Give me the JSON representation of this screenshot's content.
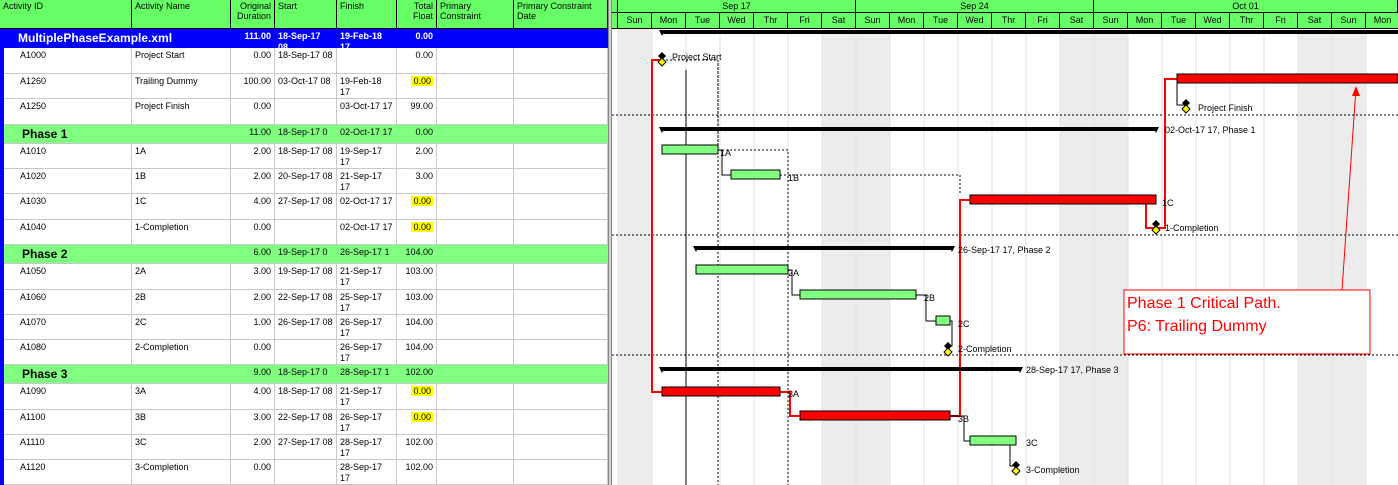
{
  "columns": {
    "activity_id": "Activity ID",
    "activity_name": "Activity Name",
    "original_duration": "Original Duration",
    "start": "Start",
    "finish": "Finish",
    "total_float": "Total Float",
    "primary_constraint": "Primary Constraint",
    "primary_constraint_date": "Primary Constraint Date"
  },
  "rows": [
    {
      "kind": "project",
      "id": "",
      "name": "MultiplePhaseExample.xml",
      "dur": "111.00",
      "start": "18-Sep-17 08",
      "finish": "19-Feb-18 17",
      "float": "0.00",
      "float_hl": false
    },
    {
      "kind": "act",
      "id": "A1000",
      "name": "Project Start",
      "dur": "0.00",
      "start": "18-Sep-17 08",
      "finish": "",
      "float": "0.00",
      "float_hl": false
    },
    {
      "kind": "act",
      "id": "A1260",
      "name": "Trailing Dummy",
      "dur": "100.00",
      "start": "03-Oct-17 08",
      "finish": "19-Feb-18 17",
      "float": "0.00",
      "float_hl": true
    },
    {
      "kind": "act",
      "id": "A1250",
      "name": "Project Finish",
      "dur": "0.00",
      "start": "",
      "finish": "03-Oct-17 17",
      "float": "99.00",
      "float_hl": false
    },
    {
      "kind": "phase",
      "id": "",
      "name": "Phase 1",
      "dur": "11.00",
      "start": "18-Sep-17 0",
      "finish": "02-Oct-17 17",
      "float": "0.00",
      "float_hl": false
    },
    {
      "kind": "act",
      "id": "A1010",
      "name": "1A",
      "dur": "2.00",
      "start": "18-Sep-17 08",
      "finish": "19-Sep-17 17",
      "float": "2.00",
      "float_hl": false
    },
    {
      "kind": "act",
      "id": "A1020",
      "name": "1B",
      "dur": "2.00",
      "start": "20-Sep-17 08",
      "finish": "21-Sep-17 17",
      "float": "3.00",
      "float_hl": false
    },
    {
      "kind": "act",
      "id": "A1030",
      "name": "1C",
      "dur": "4.00",
      "start": "27-Sep-17 08",
      "finish": "02-Oct-17 17",
      "float": "0.00",
      "float_hl": true
    },
    {
      "kind": "act",
      "id": "A1040",
      "name": "1-Completion",
      "dur": "0.00",
      "start": "",
      "finish": "02-Oct-17 17",
      "float": "0.00",
      "float_hl": true
    },
    {
      "kind": "phase",
      "id": "",
      "name": "Phase 2",
      "dur": "6.00",
      "start": "19-Sep-17 0",
      "finish": "26-Sep-17 1",
      "float": "104.00",
      "float_hl": false
    },
    {
      "kind": "act",
      "id": "A1050",
      "name": "2A",
      "dur": "3.00",
      "start": "19-Sep-17 08",
      "finish": "21-Sep-17 17",
      "float": "103.00",
      "float_hl": false
    },
    {
      "kind": "act",
      "id": "A1060",
      "name": "2B",
      "dur": "2.00",
      "start": "22-Sep-17 08",
      "finish": "25-Sep-17 17",
      "float": "103.00",
      "float_hl": false
    },
    {
      "kind": "act",
      "id": "A1070",
      "name": "2C",
      "dur": "1.00",
      "start": "26-Sep-17 08",
      "finish": "26-Sep-17 17",
      "float": "104.00",
      "float_hl": false
    },
    {
      "kind": "act",
      "id": "A1080",
      "name": "2-Completion",
      "dur": "0.00",
      "start": "",
      "finish": "26-Sep-17 17",
      "float": "104.00",
      "float_hl": false
    },
    {
      "kind": "phase",
      "id": "",
      "name": "Phase 3",
      "dur": "9.00",
      "start": "18-Sep-17 0",
      "finish": "28-Sep-17 1",
      "float": "102.00",
      "float_hl": false
    },
    {
      "kind": "act",
      "id": "A1090",
      "name": "3A",
      "dur": "4.00",
      "start": "18-Sep-17 08",
      "finish": "21-Sep-17 17",
      "float": "0.00",
      "float_hl": true
    },
    {
      "kind": "act",
      "id": "A1100",
      "name": "3B",
      "dur": "3.00",
      "start": "22-Sep-17 08",
      "finish": "26-Sep-17 17",
      "float": "0.00",
      "float_hl": true
    },
    {
      "kind": "act",
      "id": "A1110",
      "name": "3C",
      "dur": "2.00",
      "start": "27-Sep-17 08",
      "finish": "28-Sep-17 17",
      "float": "102.00",
      "float_hl": false
    },
    {
      "kind": "act",
      "id": "A1120",
      "name": "3-Completion",
      "dur": "0.00",
      "start": "",
      "finish": "28-Sep-17 17",
      "float": "102.00",
      "float_hl": false
    }
  ],
  "timescale": {
    "weeks": [
      "",
      "Sep 17",
      "Sep 24",
      "Oct 01"
    ],
    "days": [
      "Sun",
      "Mon",
      "Tue",
      "Wed",
      "Thr",
      "Fri",
      "Sat",
      "Sun",
      "Mon",
      "Tue",
      "Wed",
      "Thr",
      "Fri",
      "Sat",
      "Sun",
      "Mon",
      "Tue",
      "Wed",
      "Thr",
      "Fri",
      "Sat",
      "Sun",
      "Mon"
    ]
  },
  "bar_labels": {
    "project_start": "Project Start",
    "project_finish": "Project Finish",
    "phase1_summary": "02-Oct-17 17, Phase 1",
    "phase2_summary": "26-Sep-17 17, Phase 2",
    "phase3_summary": "28-Sep-17 17, Phase 3",
    "a1a": "1A",
    "a1b": "1B",
    "a1c": "1C",
    "a1done": "1-Completion",
    "a2a": "2A",
    "a2b": "2B",
    "a2c": "2C",
    "a2done": "2-Completion",
    "a3a": "3A",
    "a3b": "3B",
    "a3c": "3C",
    "a3done": "3-Completion"
  },
  "annotation": {
    "line1": "Phase 1 Critical Path.",
    "line2": "P6: Trailing Dummy"
  },
  "colors": {
    "header_green": "#66ff66",
    "phase_band": "#80ff80",
    "project_band": "#0000ff",
    "critical_bar": "#ff0000",
    "normal_bar": "#80ff80",
    "float_highlight": "#ffff00"
  }
}
